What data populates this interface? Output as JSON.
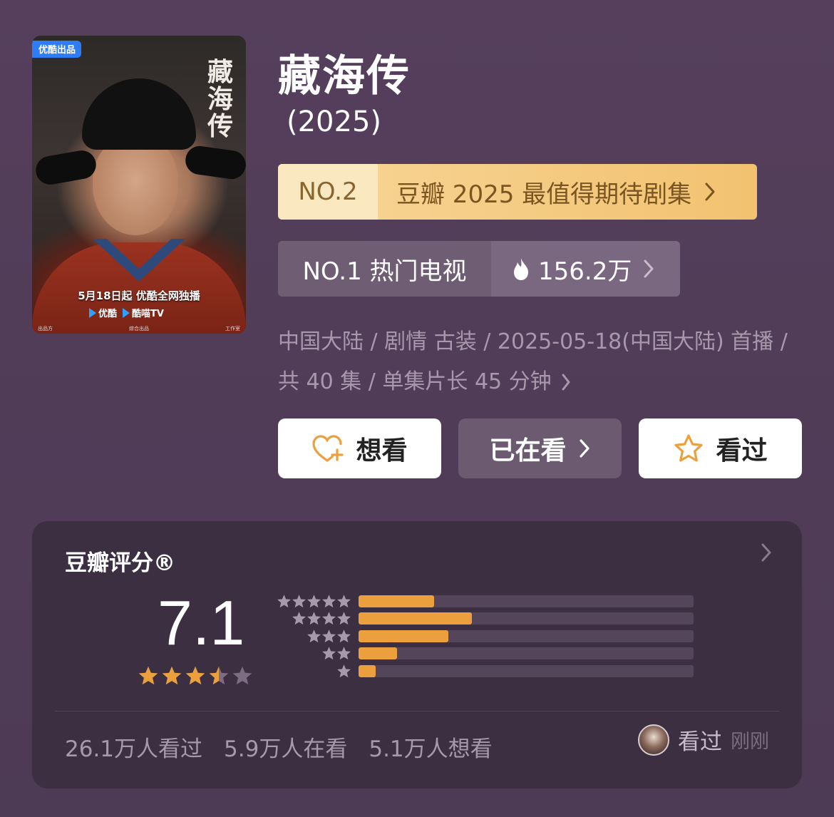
{
  "poster": {
    "badge": "优酷出品",
    "vertical_title": "藏海传",
    "promo": "5月18日起 优酷全网独播",
    "platform1": "优酷",
    "platform2": "酷喵TV",
    "credit_left": "出品方",
    "credit_mid": "综合出品",
    "credit_right": "工作室"
  },
  "title": "藏海传",
  "year": "(2025)",
  "rank_top": {
    "no": "NO.2",
    "label": "豆瓣 2025 最值得期待剧集"
  },
  "rank_hot": {
    "no": "NO.1 热门电视",
    "heat": "156.2万"
  },
  "meta_line": "中国大陆 / 剧情 古装 / 2025-05-18(中国大陆) 首播 / 共 40 集 / 单集片长 45 分钟",
  "buttons": {
    "want": "想看",
    "watching": "已在看",
    "watched": "看过"
  },
  "rating": {
    "heading": "豆瓣评分®",
    "score": "7.1",
    "star_level": 3.5,
    "distribution": [
      {
        "stars": 5,
        "fraction": 0.225
      },
      {
        "stars": 4,
        "fraction": 0.338
      },
      {
        "stars": 3,
        "fraction": 0.268
      },
      {
        "stars": 2,
        "fraction": 0.115
      },
      {
        "stars": 1,
        "fraction": 0.052
      }
    ],
    "counts": [
      "26.1万人看过",
      "5.9万人在看",
      "5.1万人想看"
    ],
    "recent_action": "看过",
    "recent_time": "刚刚"
  },
  "colors": {
    "accent": "#eba03d",
    "background": "#4e3b55",
    "card": "#3d2f42"
  }
}
